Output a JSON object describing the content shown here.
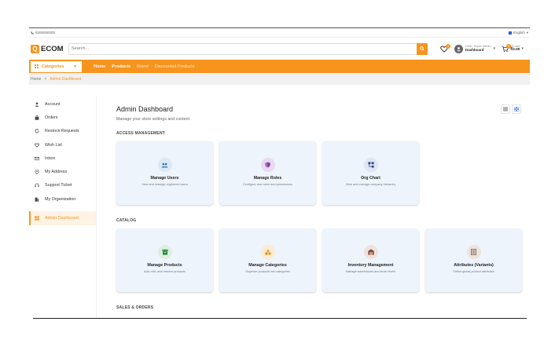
{
  "topbar": {
    "phone": "9200000000",
    "language": "English"
  },
  "header": {
    "logo_letter": "Q",
    "logo_text": "ECOM",
    "search_placeholder": "Search...",
    "wishlist_count": "0",
    "user_greeting": "Hello, Super Admin",
    "user_menu": "Dashboard",
    "cart_count": "0",
    "cart_label": "My cart",
    "cart_total": "₹0.00"
  },
  "nav": {
    "categories_label": "Categories",
    "links": [
      "Home",
      "Products",
      "Brand",
      "Discounted Products"
    ]
  },
  "breadcrumb": {
    "home": "Home",
    "separator": ">",
    "current": "Admin Dashboard"
  },
  "sidebar": {
    "items": [
      "Account",
      "Orders",
      "Restock Requests",
      "Wish List",
      "Inbox",
      "My Address",
      "Support Ticket",
      "My Organization"
    ],
    "active": "Admin Dashboard"
  },
  "main": {
    "title": "Admin Dashboard",
    "subtitle": "Manage your store settings and content",
    "sections": [
      {
        "heading": "ACCESS MANAGEMENT",
        "cards": [
          {
            "title": "Manage Users",
            "desc": "View and manage registered users",
            "icon": "users-icon",
            "icon_bg": "#dbe8f6",
            "icon_color": "#2f6fb3"
          },
          {
            "title": "Manage Roles",
            "desc": "Configure user roles and permissions",
            "icon": "shield-icon",
            "icon_bg": "#ead9f1",
            "icon_color": "#7b3aa1"
          },
          {
            "title": "Org Chart",
            "desc": "View and manage company hierarchy",
            "icon": "org-chart-icon",
            "icon_bg": "#dfe5f2",
            "icon_color": "#304a86"
          }
        ]
      },
      {
        "heading": "CATALOG",
        "cards": [
          {
            "title": "Manage Products",
            "desc": "Add, edit, and remove products",
            "icon": "box-icon",
            "icon_bg": "#dcefe0",
            "icon_color": "#2f8a45"
          },
          {
            "title": "Manage Categories",
            "desc": "Organize products into categories",
            "icon": "shapes-icon",
            "icon_bg": "#fbebd2",
            "icon_color": "#e39419"
          },
          {
            "title": "Inventory Management",
            "desc": "Manage warehouses and stock levels",
            "icon": "warehouse-icon",
            "icon_bg": "#f1e1dc",
            "icon_color": "#7b4a3a"
          },
          {
            "title": "Attributes (Variants)",
            "desc": "Define global product attributes",
            "icon": "list-icon",
            "icon_bg": "#ece3de",
            "icon_color": "#6b4a3a"
          }
        ]
      },
      {
        "heading": "SALES & ORDERS"
      }
    ]
  },
  "colors": {
    "accent": "#f7941d",
    "card_bg": "#eef4fc"
  }
}
